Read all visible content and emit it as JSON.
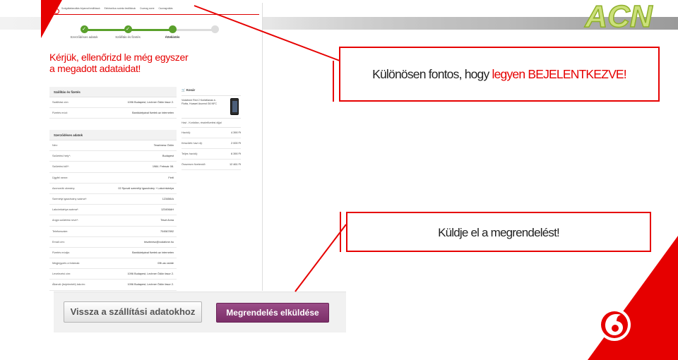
{
  "brand": {
    "logo_text": "ACN",
    "accent": "#e60000",
    "ok_green": "#5aa02c",
    "submit_purple": "#7b2e68"
  },
  "nav": {
    "items": [
      "Szolgáltatásváltás folyamat beállítások",
      "Elektronikus számla beállítások",
      "Csomag csere",
      "Csomagváltás"
    ]
  },
  "steps": [
    {
      "label": "Szerződéses adatok",
      "done": true
    },
    {
      "label": "Szállítás és fizetés",
      "done": true
    },
    {
      "label": "Áttekintés",
      "done": true,
      "active": true
    },
    {
      "label": "",
      "done": false
    }
  ],
  "headline_line1": "Kérjük, ellenőrizd le még egyszer",
  "headline_line2": "a megadott adataidat!",
  "shipping": {
    "title": "Szállítás és fizetés",
    "rows": [
      {
        "k": "Szállítási cím:",
        "v": "1096 Budapest, Lechner Ödön fasor 2."
      },
      {
        "k": "Fizetés mód:",
        "v": "Bankkártyával fizetek az interneten"
      }
    ]
  },
  "contract": {
    "title": "Szerződéses adatok",
    "rows": [
      {
        "k": "Név:",
        "v": "Tesztmesz Ödön"
      },
      {
        "k": "Születési hely*:",
        "v": "Budapest"
      },
      {
        "k": "Születési idő*:",
        "v": "1984. Február 08."
      },
      {
        "k": "Ügyfél neme:",
        "v": "Férfi"
      },
      {
        "k": "Azonosító okmány:",
        "v": "02 Spuvál személyi igazolvány + Lakcímkártya"
      },
      {
        "k": "Személyi igazolvány száma*:",
        "v": "123456IA"
      },
      {
        "k": "Lakcímkártya száma*:",
        "v": "123456AH"
      },
      {
        "k": "Anyja születési neve*:",
        "v": "Teszt Anna"
      },
      {
        "k": "Telefonszám:",
        "v": "704567892"
      },
      {
        "k": "Email cím:",
        "v": "tesztmesz@vodafone.hu"
      },
      {
        "k": "Fizetés módja:",
        "v": "Bankkártyával fizetek az interneten"
      },
      {
        "k": "Megjegyzés a futárnak:",
        "v": "09h-as csöde"
      },
      {
        "k": "Levelezési cím:",
        "v": "1096 Budapest, Lechner Ödön fasor 2."
      },
      {
        "k": "Állandó (bejelentett) lakcím:",
        "v": "1096 Budapest, Lechner Ödön fasor 2."
      }
    ]
  },
  "cart": {
    "title": "Kosár",
    "product": "Vodafone Red 2 Korlátlanas e-Flotta, Huawei Ascend G6 NFC",
    "tariff": "Havi - Korlátlan, részletfizetési díjjal",
    "rows": [
      {
        "k": "Havidíj:",
        "v": "4 390 Ft"
      },
      {
        "k": "Készülék havi díj:",
        "v": "2 000 Ft"
      },
      {
        "k": "Teljes havidíj:",
        "v": "6 390 Ft"
      },
      {
        "k": "Összesen fizetendő:",
        "v": "12 461 Ft"
      }
    ]
  },
  "buttons": {
    "back": "Vissza a szállítási adatokhoz",
    "submit": "Megrendelés elküldése"
  },
  "callout1": {
    "prefix": "Különösen fontos, hogy ",
    "highlight": "legyen BEJELENTKEZVE!"
  },
  "callout2": {
    "text": "Küldje el a megrendelést!"
  }
}
